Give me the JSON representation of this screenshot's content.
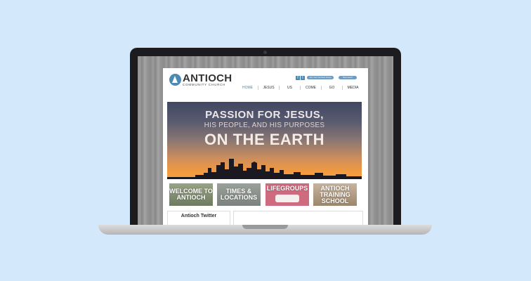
{
  "site": {
    "logo_name": "ANTIOCH",
    "logo_sub": "COMMUNITY CHURCH",
    "social": [
      "f",
      "t"
    ],
    "pill_1": "Join Your Connect Group",
    "pill_2": "New Here?",
    "nav": [
      "HOME",
      "JESUS",
      "US",
      "COME",
      "GO",
      "MEDIA"
    ],
    "hero": {
      "line1": "PASSION FOR JESUS,",
      "line2": "HIS PEOPLE, AND HIS PURPOSES",
      "line3": "ON THE EARTH"
    },
    "tiles": [
      "WELCOME TO ANTIOCH",
      "TIMES & LOCATIONS",
      "LIFEGROUPS",
      "ANTIOCH TRAINING SCHOOL"
    ],
    "twitter_title": "Antioch Twitter"
  },
  "colors": {
    "accent": "#4a8ab5",
    "background": "#d4e8fb"
  }
}
